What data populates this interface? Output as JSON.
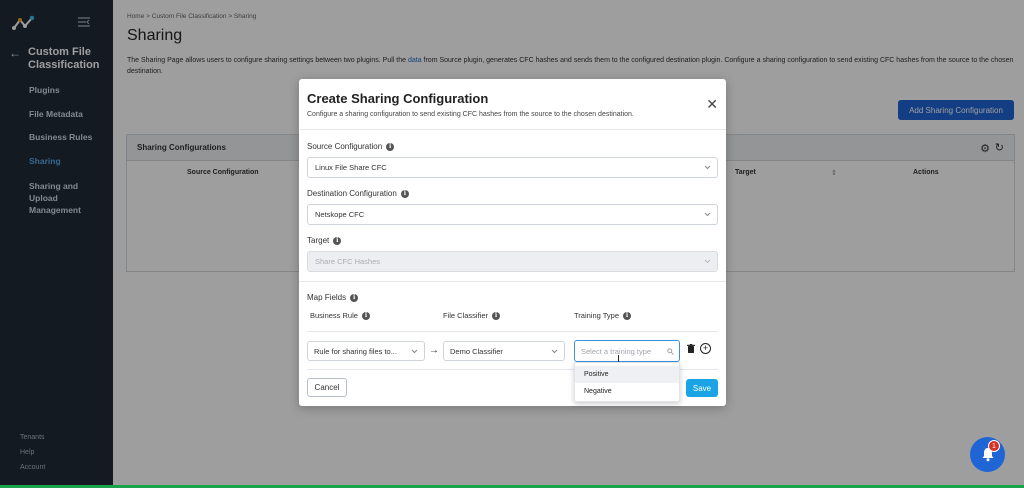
{
  "sidebar": {
    "back_icon": "arrow-left-icon",
    "module_title": "Custom File Classification",
    "items": [
      {
        "label": "Plugins",
        "active": false
      },
      {
        "label": "File Metadata",
        "active": false
      },
      {
        "label": "Business Rules",
        "active": false
      },
      {
        "label": "Sharing",
        "active": true
      },
      {
        "label": "Sharing and Upload Management",
        "active": false
      }
    ],
    "bottom_items": [
      "Tenants",
      "Help",
      "Account"
    ]
  },
  "main": {
    "breadcrumb": "Home  >  Custom File Classification  >  Sharing",
    "title": "Sharing",
    "description_pre": "The Sharing Page allows users to configure sharing settings between two plugins. Pull the ",
    "description_link": "data",
    "description_post": " from Source plugin, generates CFC hashes and sends them to the configured destination plugin. Configure a sharing configuration to send existing CFC hashes from the source to the chosen destination.",
    "add_button": "Add Sharing Configuration",
    "card_title": "Sharing Configurations",
    "columns": [
      "Source Configuration",
      "Target",
      "Actions"
    ]
  },
  "modal": {
    "title": "Create Sharing Configuration",
    "subtitle": "Configure a sharing configuration to send existing CFC hashes from the source to the chosen destination.",
    "source_label": "Source Configuration",
    "source_value": "Linux File Share CFC",
    "destination_label": "Destination Configuration",
    "destination_value": "Netskope CFC",
    "target_label": "Target",
    "target_value": "Share CFC Hashes",
    "map_fields_label": "Map Fields",
    "business_rule_label": "Business Rule",
    "file_classifier_label": "File Classifier",
    "training_type_label": "Training Type",
    "business_rule_value": "Rule for sharing files to...",
    "file_classifier_value": "Demo Classifier",
    "training_type_placeholder": "Select a training type",
    "cancel": "Cancel",
    "save": "Save"
  },
  "dropdown": {
    "options": [
      "Positive",
      "Negative"
    ]
  },
  "notification": {
    "count": "1"
  },
  "colors": {
    "sidebar_bg": "#1f2a37",
    "primary": "#1f65d6",
    "save": "#1aa4e6",
    "badge": "#d93025"
  }
}
